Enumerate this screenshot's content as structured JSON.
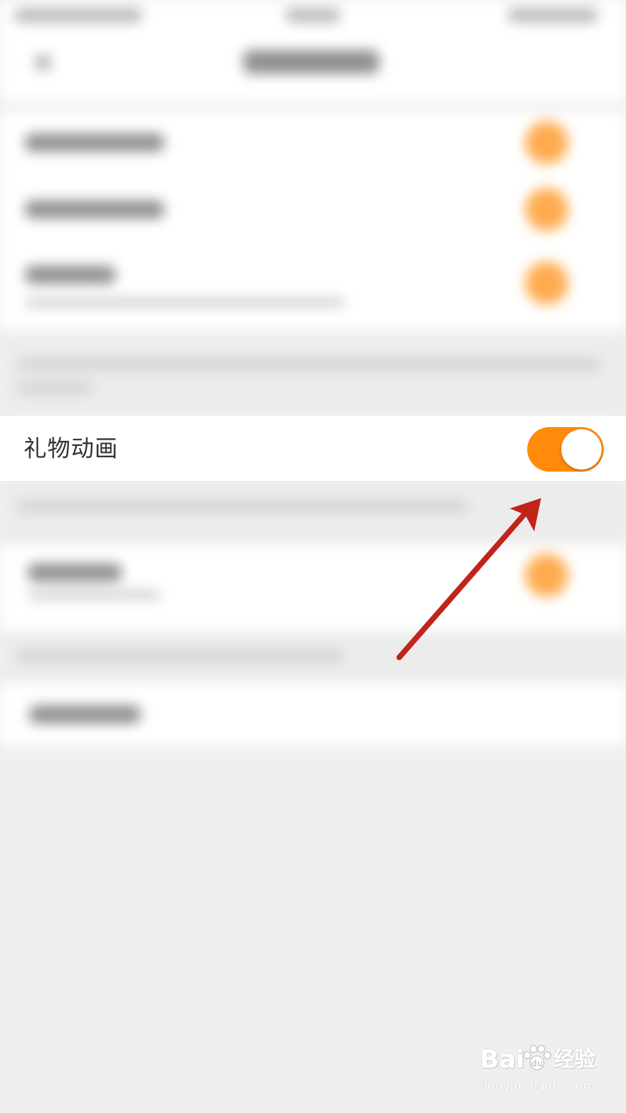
{
  "setting_row": {
    "label": "礼物动画",
    "toggle_state": "on"
  },
  "colors": {
    "toggle_on": "#ff8a0b",
    "arrow": "#c0241b",
    "background": "#efefef"
  },
  "watermark": {
    "logo": "Baidu经验",
    "url": "jingyan.baidu.com"
  }
}
